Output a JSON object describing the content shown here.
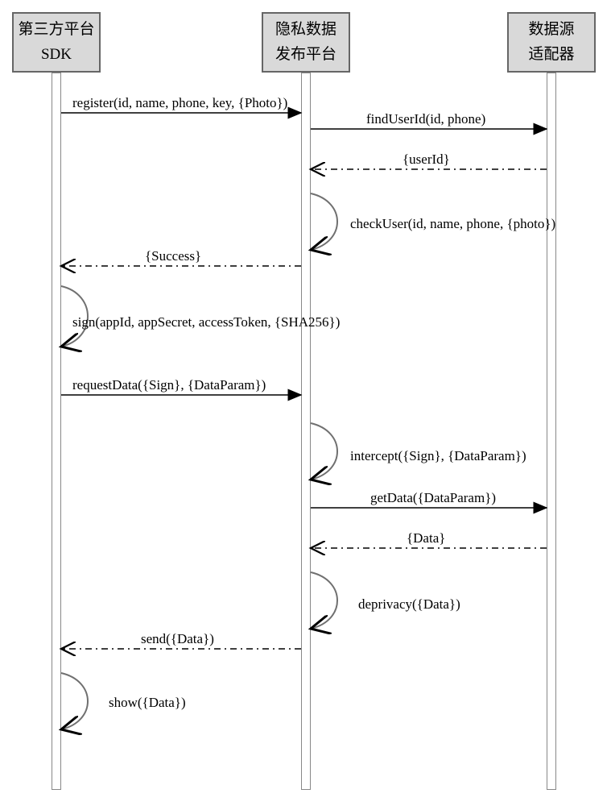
{
  "participants": {
    "p1": {
      "line1": "第三方平台",
      "line2": "SDK"
    },
    "p2": {
      "line1": "隐私数据",
      "line2": "发布平台"
    },
    "p3": {
      "line1": "数据源",
      "line2": "适配器"
    }
  },
  "messages": {
    "m1": "register(id, name, phone, key, {Photo})",
    "m2": "findUserId(id, phone)",
    "m3": "{userId}",
    "m4": "checkUser(id, name, phone, {photo})",
    "m5": "{Success}",
    "m6": "sign(appId, appSecret, accessToken, {SHA256})",
    "m7": "requestData({Sign}, {DataParam})",
    "m8": "intercept({Sign}, {DataParam})",
    "m9": "getData({DataParam})",
    "m10": "{Data}",
    "m11": "deprivacy({Data})",
    "m12": "send({Data})",
    "m13": "show({Data})"
  },
  "chart_data": {
    "type": "sequence-diagram",
    "participants": [
      "第三方平台 SDK",
      "隐私数据 发布平台",
      "数据源 适配器"
    ],
    "interactions": [
      {
        "from": 0,
        "to": 1,
        "style": "solid",
        "kind": "call",
        "label": "register(id, name, phone, key, {Photo})"
      },
      {
        "from": 1,
        "to": 2,
        "style": "solid",
        "kind": "call",
        "label": "findUserId(id, phone)"
      },
      {
        "from": 2,
        "to": 1,
        "style": "dashed",
        "kind": "return",
        "label": "{userId}"
      },
      {
        "from": 1,
        "to": 1,
        "style": "solid",
        "kind": "self",
        "label": "checkUser(id, name, phone, {photo})"
      },
      {
        "from": 1,
        "to": 0,
        "style": "dashed",
        "kind": "return",
        "label": "{Success}"
      },
      {
        "from": 0,
        "to": 0,
        "style": "solid",
        "kind": "self",
        "label": "sign(appId, appSecret, accessToken, {SHA256})"
      },
      {
        "from": 0,
        "to": 1,
        "style": "solid",
        "kind": "call",
        "label": "requestData({Sign}, {DataParam})"
      },
      {
        "from": 1,
        "to": 1,
        "style": "solid",
        "kind": "self",
        "label": "intercept({Sign}, {DataParam})"
      },
      {
        "from": 1,
        "to": 2,
        "style": "solid",
        "kind": "call",
        "label": "getData({DataParam})"
      },
      {
        "from": 2,
        "to": 1,
        "style": "dashed",
        "kind": "return",
        "label": "{Data}"
      },
      {
        "from": 1,
        "to": 1,
        "style": "solid",
        "kind": "self",
        "label": "deprivacy({Data})"
      },
      {
        "from": 1,
        "to": 0,
        "style": "dashed",
        "kind": "return",
        "label": "send({Data})"
      },
      {
        "from": 0,
        "to": 0,
        "style": "solid",
        "kind": "self",
        "label": "show({Data})"
      }
    ]
  }
}
